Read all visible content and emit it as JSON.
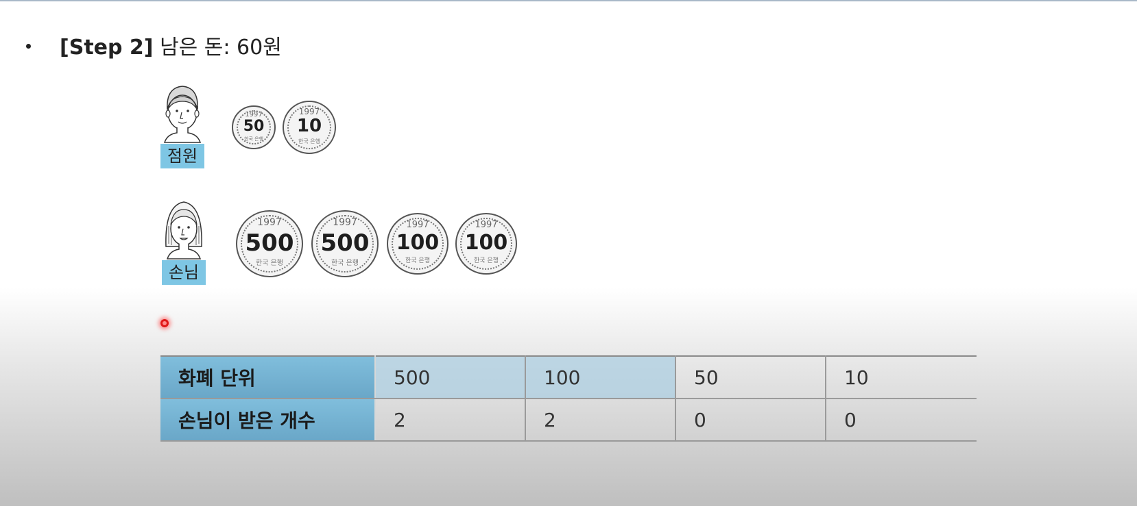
{
  "heading": {
    "step": "[Step 2]",
    "text": "남은 돈: 60원"
  },
  "clerk": {
    "label": "점원",
    "coins": [
      {
        "value": "50",
        "year": "1997",
        "bank": "한국 은행"
      },
      {
        "value": "10",
        "year": "1997",
        "bank": "한국 은행"
      }
    ]
  },
  "customer": {
    "label": "손님",
    "coins": [
      {
        "value": "500",
        "year": "1997",
        "bank": "한국 은행"
      },
      {
        "value": "500",
        "year": "1997",
        "bank": "한국 은행"
      },
      {
        "value": "100",
        "year": "1997",
        "bank": "한국 은행"
      },
      {
        "value": "100",
        "year": "1997",
        "bank": "한국 은행"
      }
    ]
  },
  "table": {
    "row_unit_label": "화폐 단위",
    "row_count_label": "손님이 받은 개수",
    "units": [
      "500",
      "100",
      "50",
      "10"
    ],
    "counts": [
      "2",
      "2",
      "0",
      "0"
    ],
    "highlight_color": "#aacde1",
    "header_color": "#7ec6e4"
  }
}
